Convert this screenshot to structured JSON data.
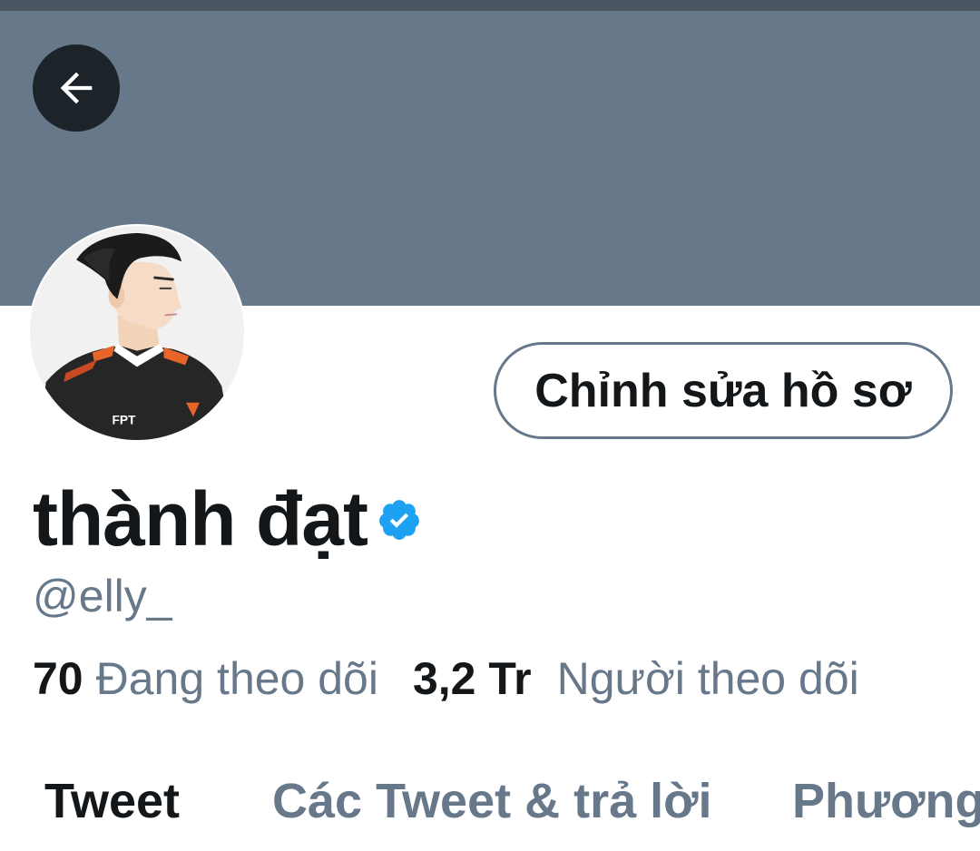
{
  "colors": {
    "banner": "#66788a",
    "status_strip": "#4b5663",
    "text_primary": "#14171a",
    "text_secondary": "#66788a",
    "verified": "#1da1f2"
  },
  "header": {
    "back_icon": "arrow-left-icon"
  },
  "profile": {
    "edit_button_label": "Chỉnh sửa hồ sơ",
    "display_name": "thành đạt",
    "verified_icon": "verified-badge-icon",
    "handle": "@elly_",
    "following_count": "70",
    "following_label": "Đang theo dõi",
    "followers_count": "3,2 Tr",
    "followers_label": "Người theo dõi",
    "avatar_jersey_text": "FPT"
  },
  "tabs": [
    {
      "label": "Tweet",
      "active": true
    },
    {
      "label": "Các Tweet & trả lời",
      "active": false
    },
    {
      "label": "Phương",
      "active": false
    }
  ]
}
